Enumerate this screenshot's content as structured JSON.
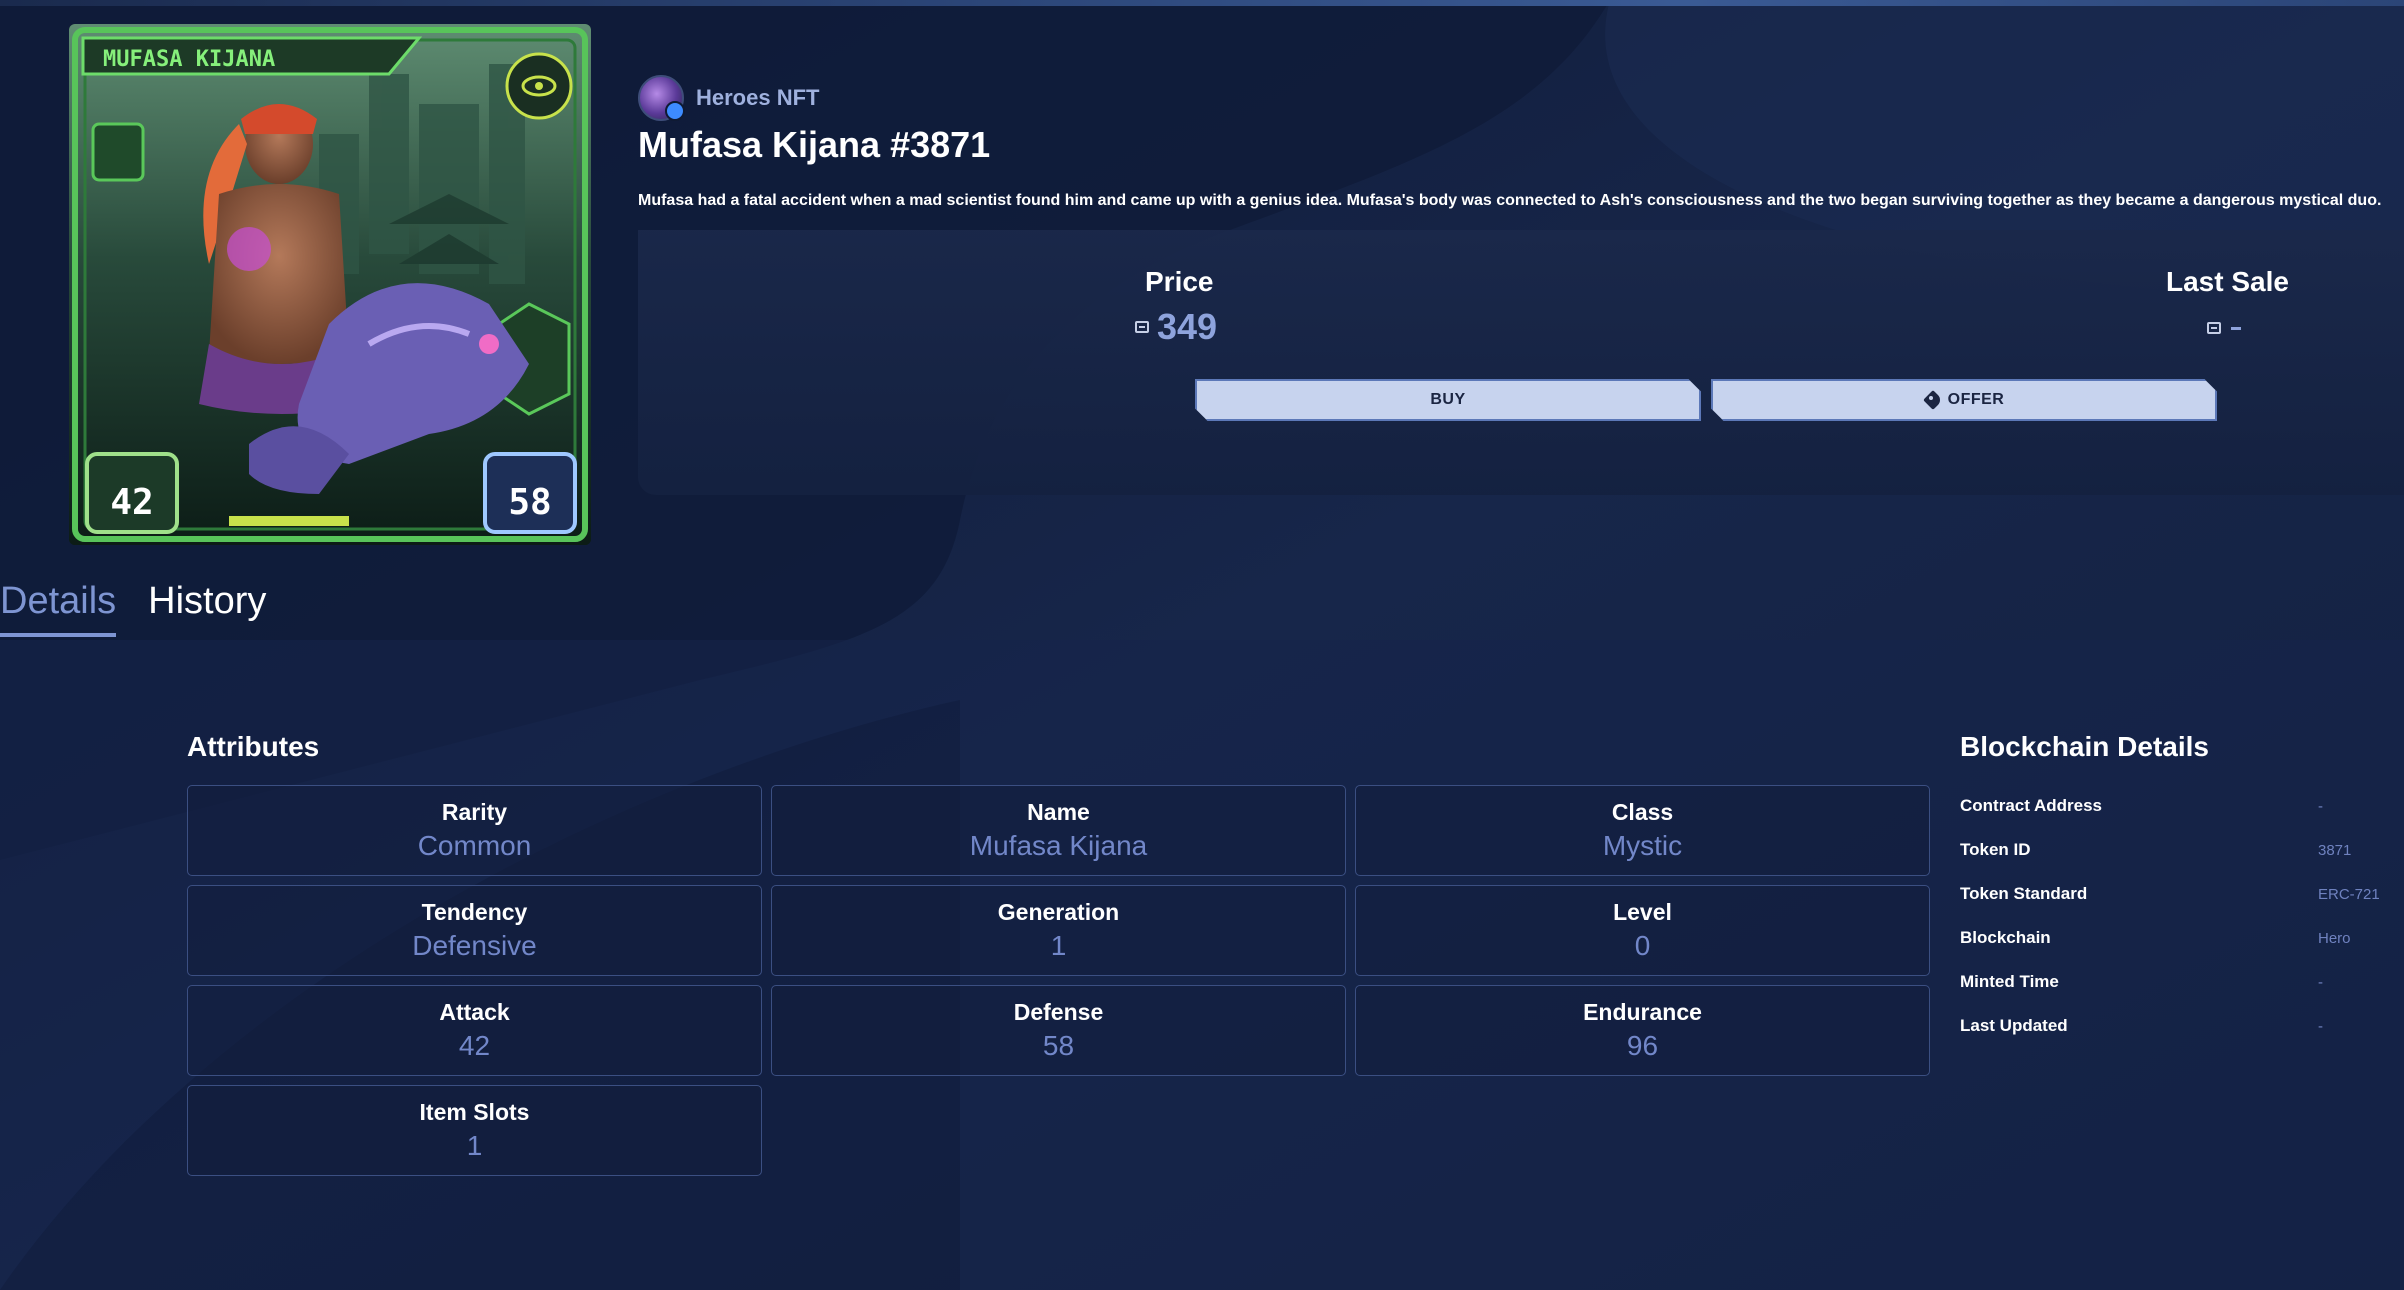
{
  "collection": {
    "name": "Heroes NFT"
  },
  "nft": {
    "title": "Mufasa Kijana #3871",
    "description": "Mufasa had a fatal accident when a mad scientist found him and came up with a genius idea. Mufasa's body was connected to Ash's consciousness and the two began surviving together as they became a dangerous mystical duo.",
    "card": {
      "name": "MUFASA KIJANA",
      "attack": "42",
      "defense": "58"
    }
  },
  "price": {
    "label": "Price",
    "value": "349"
  },
  "last_sale": {
    "label": "Last Sale",
    "value": ""
  },
  "actions": {
    "buy": "BUY",
    "offer": "OFFER"
  },
  "tabs": [
    {
      "label": "Details"
    },
    {
      "label": "History"
    }
  ],
  "attributes": {
    "title": "Attributes",
    "items": [
      {
        "label": "Rarity",
        "value": "Common"
      },
      {
        "label": "Name",
        "value": "Mufasa Kijana"
      },
      {
        "label": "Class",
        "value": "Mystic"
      },
      {
        "label": "Tendency",
        "value": "Defensive"
      },
      {
        "label": "Generation",
        "value": "1"
      },
      {
        "label": "Level",
        "value": "0"
      },
      {
        "label": "Attack",
        "value": "42"
      },
      {
        "label": "Defense",
        "value": "58"
      },
      {
        "label": "Endurance",
        "value": "96"
      },
      {
        "label": "Item Slots",
        "value": "1"
      }
    ]
  },
  "blockchain": {
    "title": "Blockchain Details",
    "rows": [
      {
        "key": "Contract Address",
        "value": "-"
      },
      {
        "key": "Token ID",
        "value": "3871"
      },
      {
        "key": "Token Standard",
        "value": "ERC-721"
      },
      {
        "key": "Blockchain",
        "value": "Hero"
      },
      {
        "key": "Minted Time",
        "value": "-"
      },
      {
        "key": "Last Updated",
        "value": "-"
      }
    ]
  },
  "colors": {
    "background": "#0f1a33",
    "accent": "#7e95d2",
    "button": "#c7d3ee",
    "card_green": "#58c45a"
  }
}
